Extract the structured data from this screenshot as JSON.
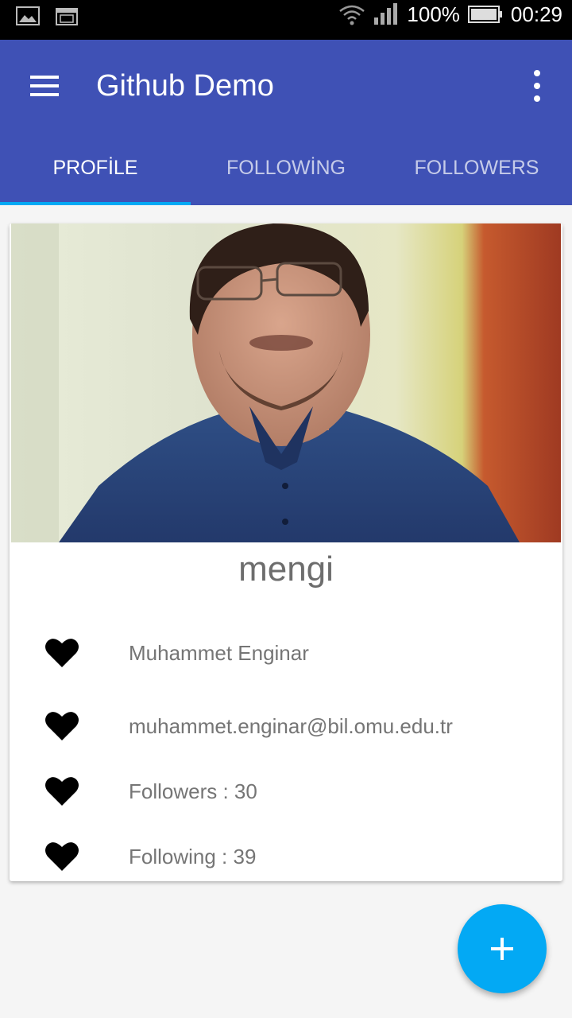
{
  "status_bar": {
    "battery": "100%",
    "time": "00:29",
    "icons": [
      "image-icon",
      "calendar-icon",
      "wifi-icon",
      "signal-icon",
      "battery-icon"
    ]
  },
  "app_bar": {
    "title": "Github Demo",
    "icons": [
      "menu-icon",
      "more-options-icon"
    ]
  },
  "tabs": [
    {
      "label": "PROFİLE",
      "active": true
    },
    {
      "label": "FOLLOWİNG",
      "active": false
    },
    {
      "label": "FOLLOWERS",
      "active": false
    }
  ],
  "profile": {
    "username": "mengi",
    "rows": [
      {
        "icon": "heart-icon",
        "text": "Muhammet Enginar"
      },
      {
        "icon": "heart-icon",
        "text": "muhammet.enginar@bil.omu.edu.tr"
      },
      {
        "icon": "heart-icon",
        "text": "Followers : 30"
      },
      {
        "icon": "heart-icon",
        "text": "Following : 39"
      }
    ]
  },
  "fab": {
    "icon": "plus-icon"
  },
  "colors": {
    "primary": "#3f51b5",
    "accent": "#03a9f4",
    "status_bar": "#000000",
    "text_secondary": "#757575"
  }
}
